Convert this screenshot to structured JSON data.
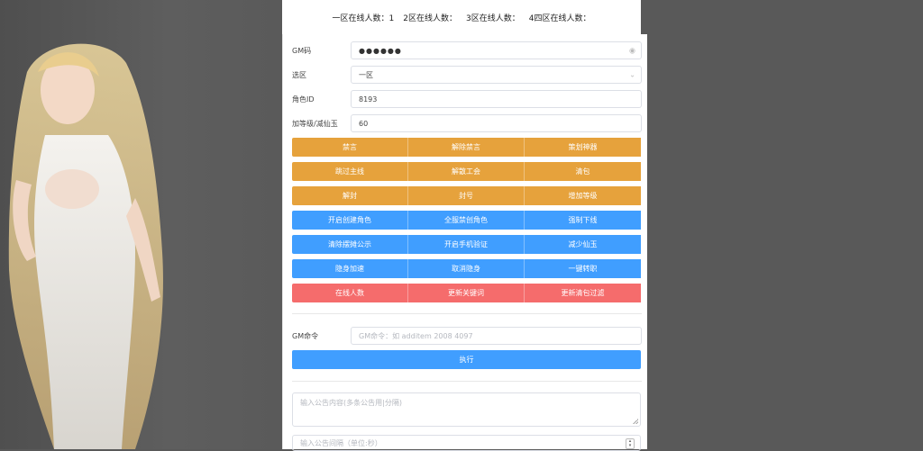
{
  "online_stats": [
    {
      "label": "一区在线人数：",
      "value": "1"
    },
    {
      "label": "2区在线人数：",
      "value": ""
    },
    {
      "label": "3区在线人数：",
      "value": ""
    },
    {
      "label": "4四区在线人数：",
      "value": ""
    }
  ],
  "form": {
    "gm_code": {
      "label": "GM码",
      "value": "●●●●●●"
    },
    "zone": {
      "label": "选区",
      "value": "一区"
    },
    "role_id": {
      "label": "角色ID",
      "value": "8193"
    },
    "level": {
      "label": "加等级/减仙玉",
      "value": "60"
    }
  },
  "buttons": {
    "orange": [
      "禁言",
      "解除禁言",
      "策划神器",
      "跳过主线",
      "解散工会",
      "清包",
      "解封",
      "封号",
      "增加等级"
    ],
    "blue": [
      "开启创建角色",
      "全服禁创角色",
      "强制下线",
      "清除摆摊公示",
      "开启手机验证",
      "减少仙玉",
      "隐身加速",
      "取消隐身",
      "一键转职"
    ],
    "red": [
      "在线人数",
      "更新关键词",
      "更新清包过滤"
    ]
  },
  "command": {
    "label": "GM命令",
    "placeholder": "GM命令：如 additem 2008 4097",
    "exec_label": "执行"
  },
  "announcement": {
    "content_placeholder": "输入公告内容(多条公告用|分隔)",
    "interval_placeholder": "输入公告间隔（单位:秒）"
  },
  "colors": {
    "orange": "#e6a23c",
    "blue": "#409eff",
    "red": "#f56c6c",
    "background": "#595959"
  },
  "icons": {
    "password_toggle": "eye-icon",
    "dropdown": "chevron-down-icon",
    "resize": "resize-handle-icon",
    "spinner": "number-spinner-icon"
  }
}
